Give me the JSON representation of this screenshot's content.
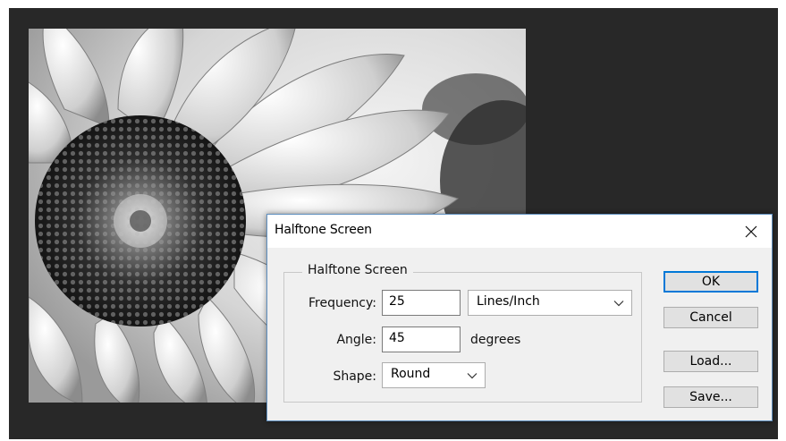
{
  "dialog": {
    "title": "Halftone Screen",
    "group_label": "Halftone Screen",
    "frequency": {
      "label": "Frequency:",
      "value": "25",
      "unit": "Lines/Inch"
    },
    "angle": {
      "label": "Angle:",
      "value": "45",
      "unit": "degrees"
    },
    "shape": {
      "label": "Shape:",
      "value": "Round"
    },
    "buttons": {
      "ok": "OK",
      "cancel": "Cancel",
      "load": "Load...",
      "save": "Save..."
    }
  },
  "icons": {
    "close": "close-icon",
    "dropdown": "chevron-down-icon"
  },
  "colors": {
    "workspace": "#282828",
    "dialog_bg": "#f0f0f0",
    "ok_border": "#0078d7",
    "dialog_border": "#5f8fbf"
  }
}
